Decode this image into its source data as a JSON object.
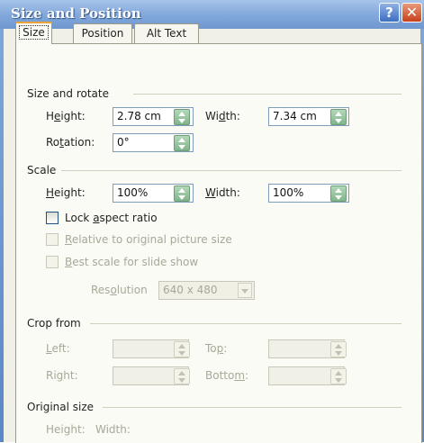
{
  "window": {
    "title": "Size and Position"
  },
  "title_buttons": {
    "help": "?",
    "close": "✕"
  },
  "tabs": [
    {
      "label": "Size",
      "active": true
    },
    {
      "label": "Position",
      "active": false
    },
    {
      "label": "Alt Text",
      "active": false
    }
  ],
  "size_rotate": {
    "header": "Size and rotate",
    "height_label_pre": "H",
    "height_label_key": "e",
    "height_label_post": "ight:",
    "height_value": "2.78 cm",
    "width_label_pre": "Wi",
    "width_label_key": "d",
    "width_label_post": "th:",
    "width_value": "7.34 cm",
    "rotation_label_pre": "Ro",
    "rotation_label_key": "t",
    "rotation_label_post": "ation:",
    "rotation_value": "0°"
  },
  "scale": {
    "header": "Scale",
    "height_label_pre": "",
    "height_label_key": "H",
    "height_label_post": "eight:",
    "height_value": "100%",
    "width_label_pre": "",
    "width_label_key": "W",
    "width_label_post": "idth:",
    "width_value": "100%",
    "lock_pre": "Lock ",
    "lock_key": "a",
    "lock_post": "spect ratio",
    "relative_pre": "",
    "relative_key": "R",
    "relative_post": "elative to original picture size",
    "best_pre": "",
    "best_key": "B",
    "best_post": "est scale for slide show",
    "resolution_pre": "Res",
    "resolution_key": "o",
    "resolution_post": "lution",
    "resolution_value": "640 x 480"
  },
  "crop": {
    "header": "Crop from",
    "left_pre": "",
    "left_key": "L",
    "left_post": "eft:",
    "top_pre": "To",
    "top_key": "p",
    "top_post": ":",
    "right_pre": "Ri",
    "right_key": "g",
    "right_post": "ht:",
    "bottom_pre": "Botto",
    "bottom_key": "m",
    "bottom_post": ":"
  },
  "original": {
    "header": "Original size",
    "height_label": "Height:",
    "width_label": "Width:"
  },
  "colors": {
    "title_bar": "#86abdc",
    "dialog_bg": "#f1f0e6",
    "spin_green": "#7fb58a",
    "close_red": "#c7401b",
    "tab_highlight": "#e8a33c"
  }
}
